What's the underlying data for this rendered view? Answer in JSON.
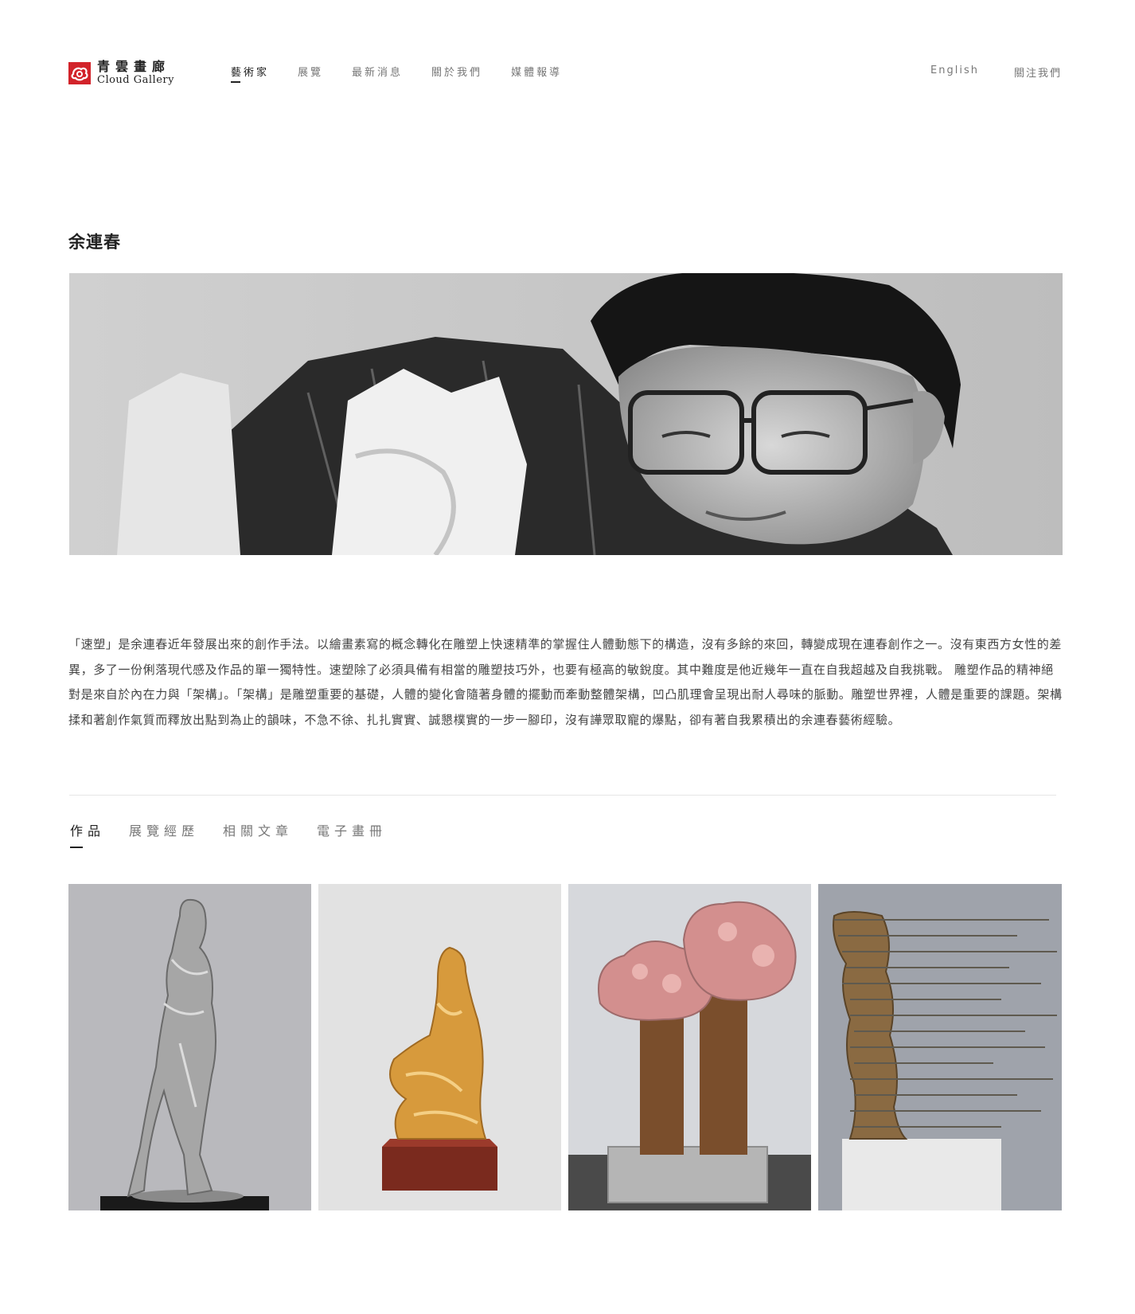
{
  "header": {
    "logo": {
      "cn": "青雲畫廊",
      "en": "Cloud Gallery",
      "icon": "cloud-gallery-logo-icon"
    },
    "nav": [
      {
        "label": "藝術家",
        "active": true
      },
      {
        "label": "展覽",
        "active": false
      },
      {
        "label": "最新消息",
        "active": false
      },
      {
        "label": "關於我們",
        "active": false
      },
      {
        "label": "媒體報導",
        "active": false
      }
    ],
    "util": [
      {
        "label": "English"
      },
      {
        "label": "關注我們"
      }
    ]
  },
  "artist": {
    "name": "余連春",
    "bio": "「速塑」是余連春近年發展出來的創作手法。以繪畫素寫的概念轉化在雕塑上快速精準的掌握住人體動態下的構造，沒有多餘的來回，轉變成現在連春創作之一。沒有東西方女性的差異，多了一份俐落現代感及作品的單一獨特性。速塑除了必須具備有相當的雕塑技巧外，也要有極高的敏銳度。其中難度是他近幾年一直在自我超越及自我挑戰。 雕塑作品的精神絕對是來自於內在力與「架構」。「架構」是雕塑重要的基礎，人體的變化會隨著身體的擺動而牽動整體架構，凹凸肌理會呈現出耐人尋味的脈動。雕塑世界裡，人體是重要的課題。架構揉和著創作氣質而釋放出點到為止的韻味，不急不徐、扎扎實實、誠懇樸實的一步一腳印，沒有譁眾取寵的爆點，卻有著自我累積出的余連春藝術經驗。"
  },
  "tabs": [
    {
      "label": "作品",
      "active": true
    },
    {
      "label": "展覽經歷",
      "active": false
    },
    {
      "label": "相關文章",
      "active": false
    },
    {
      "label": "電子畫冊",
      "active": false
    }
  ],
  "colors": {
    "brand_red": "#d2232a",
    "text_dark": "#222222",
    "text_muted": "#777777"
  }
}
